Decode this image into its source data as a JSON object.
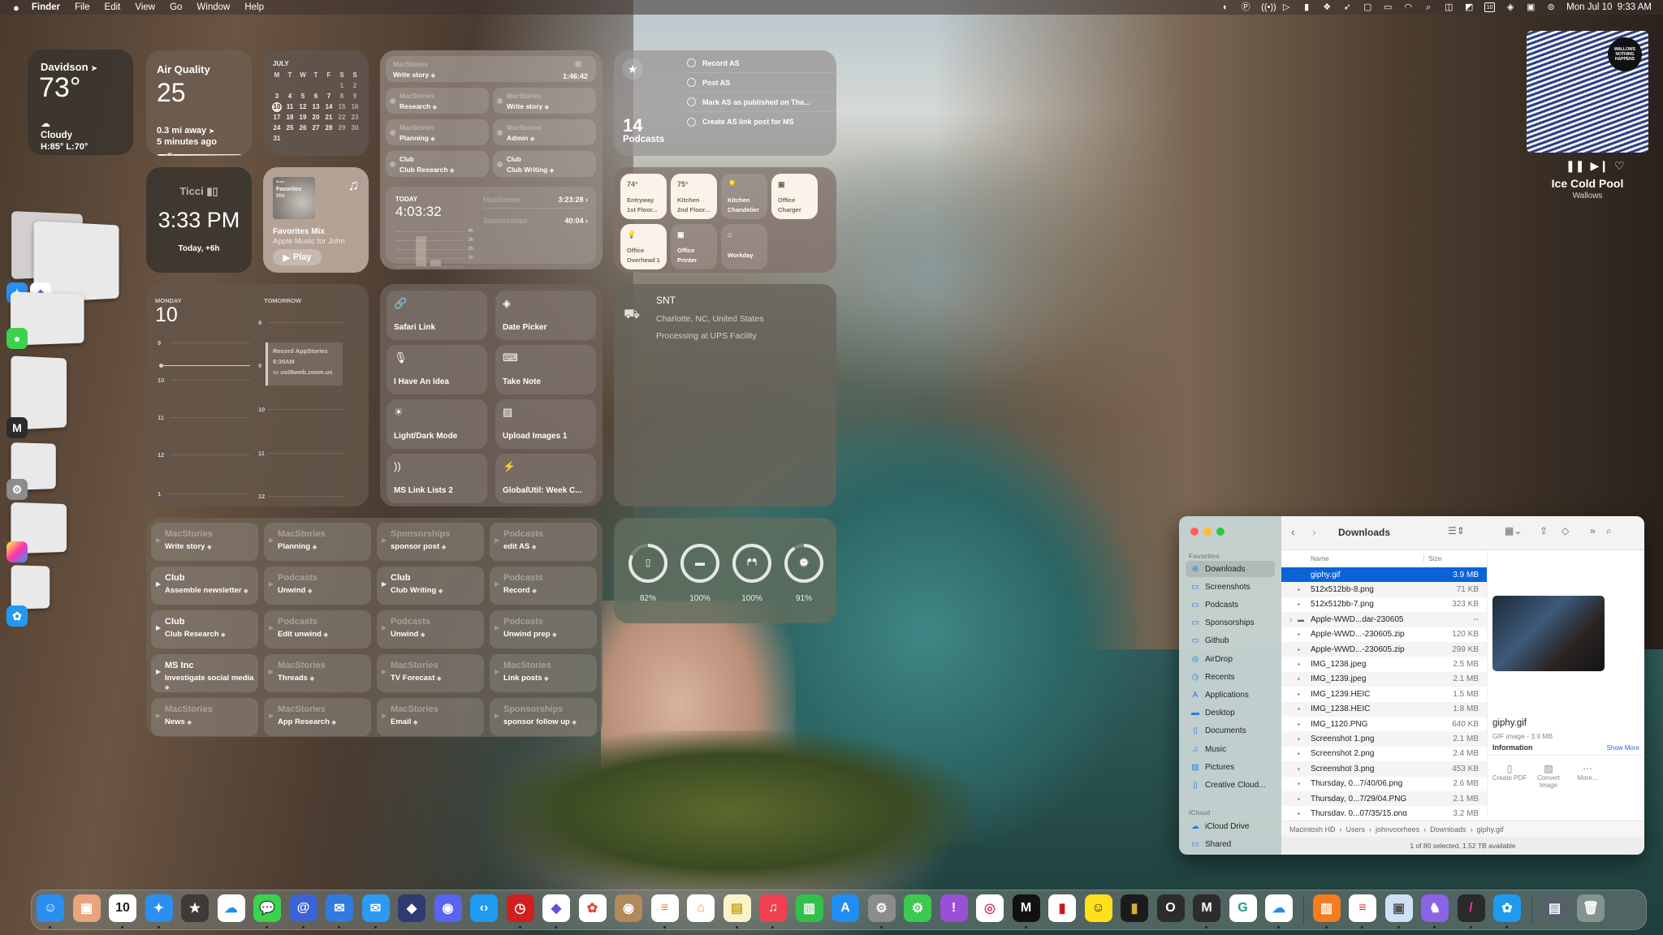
{
  "menubar": {
    "app_name": "Finder",
    "menus": [
      "File",
      "Edit",
      "View",
      "Go",
      "Window",
      "Help"
    ],
    "status_icons": [
      "pieoneer-icon",
      "pastebot-icon",
      "airplay-wireless-icon",
      "play-circle-icon",
      "bookmark-icon",
      "dropbox-icon",
      "rocket-icon",
      "phone-mirror-icon",
      "battery-icon",
      "wifi-icon",
      "spotlight-icon",
      "split-screen-icon",
      "shortcut-icon",
      "calendar-10-icon",
      "layers-icon",
      "control-icon",
      "control-center-icon"
    ],
    "calendar_badge": "10",
    "datetime": "Mon Jul 10  9:33 AM"
  },
  "weather": {
    "city": "Davidson",
    "temp": "73°",
    "condition": "Cloudy",
    "high_low": "H:85° L:70°"
  },
  "air_quality": {
    "title": "Air Quality",
    "value": "25",
    "distance": "0.3 mi away",
    "updated": "5 minutes ago",
    "level_fraction": 0.1
  },
  "calendar_month": {
    "month": "JULY",
    "weekdays": [
      "M",
      "T",
      "W",
      "T",
      "F",
      "S",
      "S"
    ],
    "weeks": [
      [
        "",
        "",
        "",
        "",
        "",
        "1",
        "2"
      ],
      [
        "3",
        "4",
        "5",
        "6",
        "7",
        "8",
        "9"
      ],
      [
        "10",
        "11",
        "12",
        "13",
        "14",
        "15",
        "16"
      ],
      [
        "17",
        "18",
        "19",
        "20",
        "21",
        "22",
        "23"
      ],
      [
        "24",
        "25",
        "26",
        "27",
        "28",
        "29",
        "30"
      ],
      [
        "31",
        "",
        "",
        "",
        "",
        "",
        ""
      ]
    ],
    "today": "10"
  },
  "world_clock": {
    "name": "Ticci",
    "time": "3:33 PM",
    "offset": "Today, +6h"
  },
  "music_widget": {
    "art_brand": "Music",
    "art_title": "Favorites",
    "art_sub": "Mix",
    "title": "Favorites Mix",
    "subtitle": "Apple Music for John",
    "play_label": "Play"
  },
  "timery": {
    "running": {
      "project": "MacStories",
      "task": "Write story",
      "elapsed": "1:46:42"
    },
    "buttons": [
      {
        "project": "MacStories",
        "task": "Research"
      },
      {
        "project": "MacStories",
        "task": "Write story"
      },
      {
        "project": "MacStories",
        "task": "Planning"
      },
      {
        "project": "MacStories",
        "task": "Admin"
      },
      {
        "project": "Club",
        "task": "Club Research"
      },
      {
        "project": "Club",
        "task": "Club Writing"
      }
    ],
    "today": {
      "label": "TODAY",
      "total": "4:03:32",
      "rows": [
        {
          "name": "MacStories",
          "time": "3:23:28"
        },
        {
          "name": "Sponsorships",
          "time": "40:04"
        }
      ],
      "y_ticks": [
        "4h",
        "3h",
        "2h",
        "1h"
      ],
      "bars_hours": [
        3.4,
        0.7
      ]
    }
  },
  "reminders": {
    "count": "14",
    "list": "Podcasts",
    "items": [
      "Record AS",
      "Post AS",
      "Mark AS as published on Tha...",
      "Create AS link post for MS"
    ]
  },
  "home": {
    "tiles": [
      {
        "l1": "Entryway",
        "l2": "1st Floor...",
        "value": "74°",
        "on": true,
        "icon": "thermometer"
      },
      {
        "l1": "Kitchen",
        "l2": "2nd Floor...",
        "value": "75°",
        "on": true,
        "icon": "thermometer"
      },
      {
        "l1": "Kitchen",
        "l2": "Chandelier",
        "value": "",
        "on": false,
        "icon": "bulb"
      },
      {
        "l1": "Office",
        "l2": "Charger",
        "value": "",
        "on": true,
        "icon": "outlet"
      },
      {
        "l1": "Office",
        "l2": "Overhead 1",
        "value": "",
        "on": true,
        "icon": "bulb"
      },
      {
        "l1": "Office",
        "l2": "Printer",
        "value": "",
        "on": false,
        "icon": "outlet"
      },
      {
        "l1": "Workday",
        "l2": "",
        "value": "",
        "on": false,
        "icon": "house"
      }
    ]
  },
  "weekly_calendar": {
    "today_label": "MONDAY",
    "today_date": "10",
    "tomorrow_label": "TOMORROW",
    "today_hours": [
      "9",
      "10",
      "11",
      "12",
      "1"
    ],
    "tomorrow_hours": [
      "8",
      "9",
      "10",
      "11",
      "12"
    ],
    "event": {
      "title": "Record AppStories",
      "time": "8:30AM",
      "location": "us06web.zoom.us"
    }
  },
  "shortcuts": [
    {
      "label": "Safari Link",
      "icon": "link-icon"
    },
    {
      "label": "Date Picker",
      "icon": "shortcuts-icon"
    },
    {
      "label": "I Have An Idea",
      "icon": "microphone-icon"
    },
    {
      "label": "Take Note",
      "icon": "keyboard-icon"
    },
    {
      "label": "Light/Dark Mode",
      "icon": "sun-icon"
    },
    {
      "label": "Upload Images 1",
      "icon": "photo-icon"
    },
    {
      "label": "MS Link Lists 2",
      "icon": "rss-icon"
    },
    {
      "label": "GlobalUtil: Week C...",
      "icon": "bolt-icon"
    }
  ],
  "package": {
    "name": "SNT",
    "location": "Charlotte, NC, United States",
    "status": "Processing at UPS Facility"
  },
  "batteries": [
    {
      "device": "iphone",
      "percent": 82
    },
    {
      "device": "airpods-case",
      "percent": 100
    },
    {
      "device": "airpods",
      "percent": 100
    },
    {
      "device": "watch",
      "percent": 91
    }
  ],
  "timery_grid": [
    {
      "project": "MacStories",
      "task": "Write story",
      "bright": false
    },
    {
      "project": "MacStories",
      "task": "Planning",
      "bright": false
    },
    {
      "project": "Sponsorships",
      "task": "sponsor post",
      "bright": false
    },
    {
      "project": "Podcasts",
      "task": "edit AS",
      "bright": false
    },
    {
      "project": "Club",
      "task": "Assemble newsletter",
      "bright": true
    },
    {
      "project": "Podcasts",
      "task": "Unwind",
      "bright": false
    },
    {
      "project": "Club",
      "task": "Club Writing",
      "bright": true
    },
    {
      "project": "Podcasts",
      "task": "Record",
      "bright": false
    },
    {
      "project": "Club",
      "task": "Club Research",
      "bright": true
    },
    {
      "project": "Podcasts",
      "task": "Edit unwind",
      "bright": false
    },
    {
      "project": "Podcasts",
      "task": "Unwind",
      "bright": false
    },
    {
      "project": "Podcasts",
      "task": "Unwind prep",
      "bright": false
    },
    {
      "project": "MS Inc",
      "task": "Investigate social media",
      "bright": true
    },
    {
      "project": "MacStories",
      "task": "Threads",
      "bright": false
    },
    {
      "project": "MacStories",
      "task": "TV Forecast",
      "bright": false
    },
    {
      "project": "MacStories",
      "task": "Link posts",
      "bright": false
    },
    {
      "project": "MacStories",
      "task": "News",
      "bright": false
    },
    {
      "project": "MacStories",
      "task": "App Research",
      "bright": false
    },
    {
      "project": "MacStories",
      "task": "Email",
      "bright": false
    },
    {
      "project": "Sponsorships",
      "task": "sponsor follow up",
      "bright": false
    }
  ],
  "now_playing": {
    "album_text": "WALLOWS NOTHING HAPPENS",
    "track": "Ice Cold Pool",
    "artist": "Wallows"
  },
  "finder": {
    "title": "Downloads",
    "sidebar": {
      "favorites_label": "Favorites",
      "favorites": [
        {
          "label": "Downloads",
          "icon": "download-circle-icon",
          "selected": true
        },
        {
          "label": "Screenshots",
          "icon": "folder-icon"
        },
        {
          "label": "Podcasts",
          "icon": "folder-icon"
        },
        {
          "label": "Sponsorships",
          "icon": "folder-icon"
        },
        {
          "label": "Github",
          "icon": "folder-icon"
        },
        {
          "label": "AirDrop",
          "icon": "airdrop-icon"
        },
        {
          "label": "Recents",
          "icon": "clock-icon"
        },
        {
          "label": "Applications",
          "icon": "applications-icon"
        },
        {
          "label": "Desktop",
          "icon": "desktop-icon"
        },
        {
          "label": "Documents",
          "icon": "document-icon"
        },
        {
          "label": "Music",
          "icon": "music-note-icon"
        },
        {
          "label": "Pictures",
          "icon": "photo-icon"
        },
        {
          "label": "Creative Cloud...",
          "icon": "document-icon"
        }
      ],
      "icloud_label": "iCloud",
      "icloud": [
        {
          "label": "iCloud Drive",
          "icon": "cloud-icon"
        },
        {
          "label": "Shared",
          "icon": "shared-folder-icon"
        }
      ]
    },
    "columns": {
      "name": "Name",
      "size": "Size"
    },
    "files": [
      {
        "name": "giphy.gif",
        "size": "3.9 MB",
        "selected": true
      },
      {
        "name": "512x512bb-8.png",
        "size": "71 KB"
      },
      {
        "name": "512x512bb-7.png",
        "size": "323 KB"
      },
      {
        "name": "Apple-WWD...dar-230605",
        "size": "--",
        "folder": true
      },
      {
        "name": "Apple-WWD...-230605.zip",
        "size": "120 KB"
      },
      {
        "name": "Apple-WWD...-230605.zip",
        "size": "299 KB"
      },
      {
        "name": "IMG_1238.jpeg",
        "size": "2.5 MB"
      },
      {
        "name": "IMG_1239.jpeg",
        "size": "2.1 MB"
      },
      {
        "name": "IMG_1239.HEIC",
        "size": "1.5 MB"
      },
      {
        "name": "IMG_1238.HEIC",
        "size": "1.8 MB"
      },
      {
        "name": "IMG_1120.PNG",
        "size": "640 KB"
      },
      {
        "name": "Screenshot 1.png",
        "size": "2.1 MB"
      },
      {
        "name": "Screenshot 2.png",
        "size": "2.4 MB"
      },
      {
        "name": "Screenshot 3.png",
        "size": "453 KB"
      },
      {
        "name": "Thursday, 0...7/40/06.png",
        "size": "2.6 MB"
      },
      {
        "name": "Thursday, 0...7/29/04.PNG",
        "size": "2.1 MB"
      },
      {
        "name": "Thursday, 0...07/35/15.png",
        "size": "3.2 MB"
      }
    ],
    "preview": {
      "name": "giphy.gif",
      "kind": "GIF image - 3.9 MB",
      "info_label": "Information",
      "show_more": "Show More",
      "actions": [
        {
          "label": "Create PDF",
          "icon": "document-icon"
        },
        {
          "label": "Convert Image",
          "icon": "convert-image-icon"
        },
        {
          "label": "More...",
          "icon": "ellipsis-circle-icon"
        }
      ]
    },
    "path": [
      "Macintosh HD",
      "Users",
      "johnvoorhees",
      "Downloads",
      "giphy.gif"
    ],
    "status": "1 of 80 selected, 1.52 TB available"
  },
  "dock": {
    "apps": [
      {
        "name": "Finder",
        "bg": "#2a8df0",
        "glyph": "☺",
        "running": true
      },
      {
        "name": "Deliveries",
        "bg": "#e9a47c",
        "glyph": "▣",
        "running": false
      },
      {
        "name": "Calendar",
        "bg": "#ffffff",
        "glyph": "10",
        "running": true,
        "fg": "#222"
      },
      {
        "name": "Safari",
        "bg": "#2a8ff0",
        "glyph": "✦",
        "running": true
      },
      {
        "name": "Reeder",
        "bg": "#3e3a38",
        "glyph": "★",
        "running": false
      },
      {
        "name": "iCloud Drive",
        "bg": "#ffffff",
        "glyph": "☁",
        "running": false,
        "fg": "#1f8fe8"
      },
      {
        "name": "Messages",
        "bg": "#3bd34e",
        "glyph": "💬",
        "running": true
      },
      {
        "name": "Spark",
        "bg": "#3b63d6",
        "glyph": "@",
        "running": true
      },
      {
        "name": "Mimestream",
        "bg": "#2f7be0",
        "glyph": "✉",
        "running": true
      },
      {
        "name": "Mail",
        "bg": "#2b9af3",
        "glyph": "✉",
        "running": true
      },
      {
        "name": "Shortcuts",
        "bg": "#2e3a70",
        "glyph": "◆",
        "running": false
      },
      {
        "name": "Discord",
        "bg": "#5865f2",
        "glyph": "◉",
        "running": false
      },
      {
        "name": "Screens",
        "bg": "#1e9af0",
        "glyph": "‹›",
        "running": false
      },
      {
        "name": "Timery",
        "bg": "#d11f1f",
        "glyph": "◷",
        "running": true
      },
      {
        "name": "Obsidian",
        "bg": "#ffffff",
        "glyph": "◆",
        "running": true,
        "fg": "#6d4bd6"
      },
      {
        "name": "Photos",
        "bg": "#ffffff",
        "glyph": "✿",
        "running": false,
        "fg": "#e0483a"
      },
      {
        "name": "Contacts",
        "bg": "#b08a5a",
        "glyph": "◉",
        "running": false
      },
      {
        "name": "Reminders",
        "bg": "#ffffff",
        "glyph": "≡",
        "running": true,
        "fg": "#ff7f2a"
      },
      {
        "name": "Home",
        "bg": "#ffffff",
        "glyph": "⌂",
        "running": false,
        "fg": "#f39a1e"
      },
      {
        "name": "Notes",
        "bg": "#fbf3c9",
        "glyph": "▤",
        "running": true,
        "fg": "#c9a422"
      },
      {
        "name": "Music",
        "bg": "#f0404f",
        "glyph": "♫",
        "running": true
      },
      {
        "name": "Numbers",
        "bg": "#32c04a",
        "glyph": "▥",
        "running": false
      },
      {
        "name": "App Store",
        "bg": "#1f8ef0",
        "glyph": "A",
        "running": false
      },
      {
        "name": "System Settings",
        "bg": "#8c8c8c",
        "glyph": "⚙",
        "running": true
      },
      {
        "name": "Automation",
        "bg": "#3cc94f",
        "glyph": "⚙",
        "running": false
      },
      {
        "name": "Feedback",
        "bg": "#9b4ed6",
        "glyph": "!",
        "running": false
      },
      {
        "name": "Instagram",
        "bg": "#ffffff",
        "glyph": "◎",
        "running": false,
        "fg": "#d64080"
      },
      {
        "name": "Mela",
        "bg": "#111111",
        "glyph": "M",
        "running": true
      },
      {
        "name": "GoodLinks",
        "bg": "#ffffff",
        "glyph": "▮",
        "running": false,
        "fg": "#c71818"
      },
      {
        "name": "Mailchimp",
        "bg": "#ffe01b",
        "glyph": "☺",
        "running": false,
        "fg": "#222"
      },
      {
        "name": "Bookmarks",
        "bg": "#1b1b1b",
        "glyph": "▮",
        "running": false,
        "fg": "#d9b12c"
      },
      {
        "name": "Opus One",
        "bg": "#2c2c2c",
        "glyph": "O",
        "running": false
      },
      {
        "name": "Mastodon",
        "bg": "#2c2c2c",
        "glyph": "M",
        "running": true
      },
      {
        "name": "Grammarly",
        "bg": "#ffffff",
        "glyph": "G",
        "running": false,
        "fg": "#16a085"
      },
      {
        "name": "CloudMounter",
        "bg": "#ffffff",
        "glyph": "☁",
        "running": true,
        "fg": "#1f8fe8"
      }
    ],
    "recent_apps": [
      {
        "name": "Books",
        "bg": "#f47d1f",
        "glyph": "▥",
        "running": true
      },
      {
        "name": "Fantastical",
        "bg": "#ffffff",
        "glyph": "≡",
        "running": true,
        "fg": "#e33"
      },
      {
        "name": "Preview",
        "bg": "#cfe1f5",
        "glyph": "▣",
        "running": true,
        "fg": "#555"
      },
      {
        "name": "TablePlus",
        "bg": "#8a63e6",
        "glyph": "♞",
        "running": true
      },
      {
        "name": "Pixelmator",
        "bg": "#2a2a2a",
        "glyph": "/",
        "running": true,
        "fg": "#f3a"
      },
      {
        "name": "Screens Photo",
        "bg": "#1f9af0",
        "glyph": "✿",
        "running": true
      }
    ],
    "folders": [
      {
        "name": "Downloads stack",
        "bg": "#55606a",
        "glyph": "▤"
      },
      {
        "name": "Trash",
        "bg": "rgba(255,255,255,0.3)",
        "glyph": "🗑"
      }
    ]
  },
  "stage_manager": [
    {
      "apps": [
        "Safari",
        "Obsidian"
      ]
    },
    {
      "apps": [
        "Messages"
      ]
    },
    {
      "apps": [
        "Mela"
      ]
    },
    {
      "apps": [
        "System Settings"
      ]
    },
    {
      "apps": [
        "Pixelmator"
      ]
    },
    {
      "apps": [
        "Screens Photo"
      ]
    }
  ]
}
